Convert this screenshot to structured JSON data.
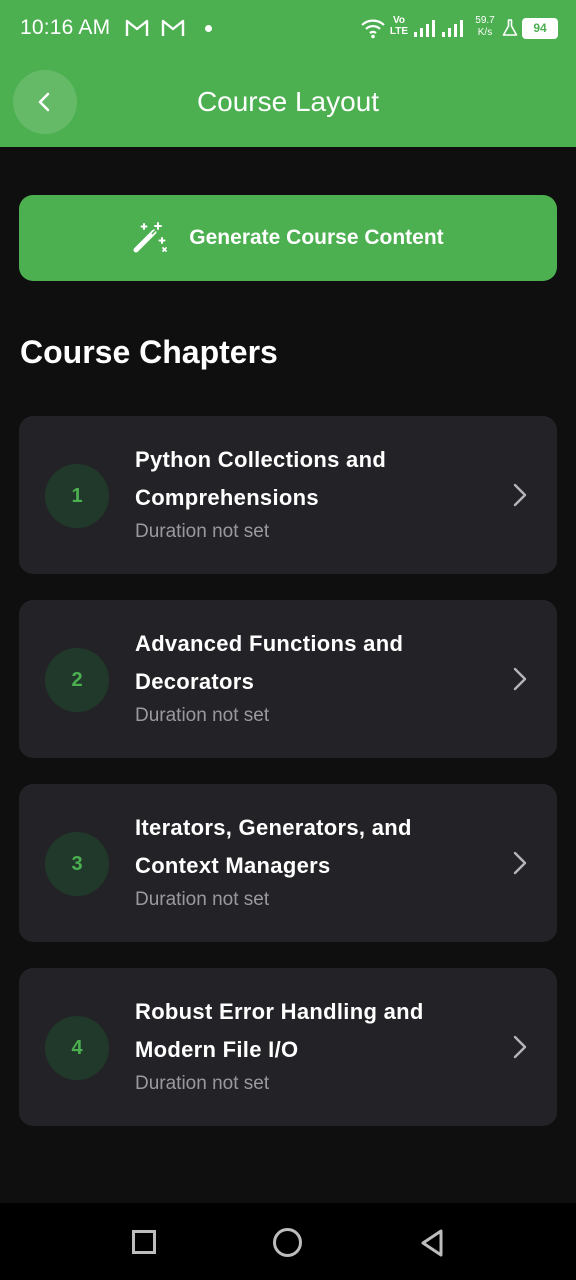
{
  "status_bar": {
    "time": "10:16 AM",
    "volte_line1": "Vo",
    "volte_line2": "LTE",
    "netspeed_value": "59.7",
    "netspeed_unit": "K/s",
    "battery": "94"
  },
  "header": {
    "title": "Course Layout",
    "back_icon": "chevron-left-icon"
  },
  "generate": {
    "label": "Generate Course Content",
    "icon": "magic-wand-icon"
  },
  "section_title": "Course Chapters",
  "chapters": [
    {
      "number": "1",
      "title": "Python Collections and Comprehensions",
      "duration": "Duration not set"
    },
    {
      "number": "2",
      "title": "Advanced Functions and Decorators",
      "duration": "Duration not set"
    },
    {
      "number": "3",
      "title": "Iterators, Generators, and Context Managers",
      "duration": "Duration not set"
    },
    {
      "number": "4",
      "title": "Robust Error Handling and Modern File I/O",
      "duration": "Duration not set"
    }
  ],
  "colors": {
    "accent": "#4caf50",
    "background": "#0f0f10",
    "card": "#232327",
    "muted_text": "#9a9a9e"
  }
}
